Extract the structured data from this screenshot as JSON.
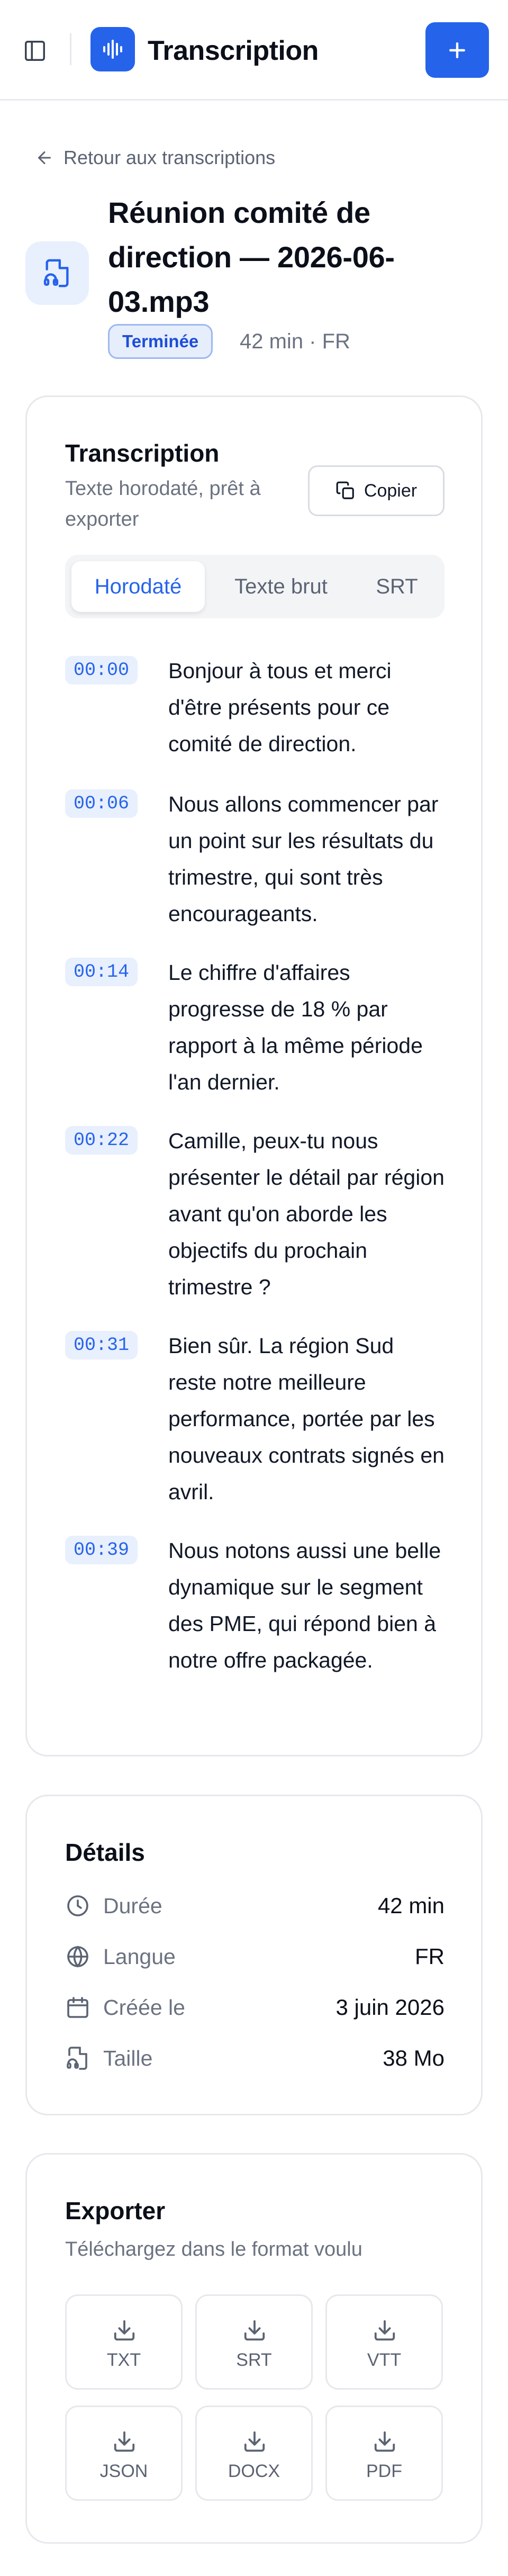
{
  "header": {
    "app_title": "Transcription",
    "icons": {
      "sidebar_toggle": "panel-left-icon",
      "logo": "audio-waveform-icon",
      "new": "plus-icon"
    },
    "accent": "#2563eb"
  },
  "back_link": {
    "label": "Retour aux transcriptions",
    "icon": "arrow-left-icon"
  },
  "file": {
    "icon": "file-audio-icon",
    "title": "Réunion comité de direction — 2026-06-03.mp3",
    "status": "Terminée",
    "meta": "42 min · FR"
  },
  "transcript_card": {
    "title": "Transcription",
    "subtitle": "Texte horodaté, prêt à exporter",
    "copy_label": "Copier",
    "tabs": [
      {
        "label": "Horodaté",
        "active": true
      },
      {
        "label": "Texte brut",
        "active": false
      },
      {
        "label": "SRT",
        "active": false
      }
    ],
    "segments": [
      {
        "time": "00:00",
        "text": "Bonjour à tous et merci d'être présents pour ce comité de direction."
      },
      {
        "time": "00:06",
        "text": "Nous allons commencer par un point sur les résultats du trimestre, qui sont très encourageants."
      },
      {
        "time": "00:14",
        "text": "Le chiffre d'affaires progresse de 18 % par rapport à la même période l'an dernier."
      },
      {
        "time": "00:22",
        "text": "Camille, peux-tu nous présenter le détail par région avant qu'on aborde les objectifs du prochain trimestre ?"
      },
      {
        "time": "00:31",
        "text": "Bien sûr. La région Sud reste notre meilleure performance, portée par les nouveaux contrats signés en avril."
      },
      {
        "time": "00:39",
        "text": "Nous notons aussi une belle dynamique sur le segment des PME, qui répond bien à notre offre packagée."
      }
    ]
  },
  "details_card": {
    "title": "Détails",
    "rows": [
      {
        "icon": "clock-icon",
        "label": "Durée",
        "value": "42 min"
      },
      {
        "icon": "globe-icon",
        "label": "Langue",
        "value": "FR"
      },
      {
        "icon": "calendar-icon",
        "label": "Créée le",
        "value": "3 juin 2026"
      },
      {
        "icon": "file-audio-icon",
        "label": "Taille",
        "value": "38 Mo"
      }
    ]
  },
  "export_card": {
    "title": "Exporter",
    "subtitle": "Téléchargez dans le format voulu",
    "formats": [
      "TXT",
      "SRT",
      "VTT",
      "JSON",
      "DOCX",
      "PDF"
    ]
  }
}
